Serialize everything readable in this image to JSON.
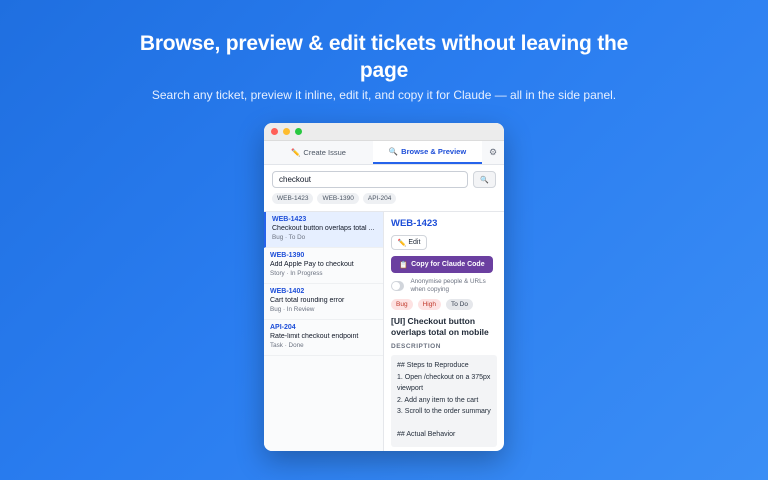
{
  "hero": {
    "title": "Browse, preview & edit tickets without leaving the page",
    "subtitle": "Search any ticket, preview it inline, edit it, and copy it for Claude — all in the side panel."
  },
  "window": {
    "traffic_lights": [
      "#ff5f57",
      "#febc2e",
      "#28c840"
    ]
  },
  "tabs": {
    "create": {
      "icon": "pencil-icon",
      "glyph": "✏️",
      "label": "Create Issue"
    },
    "browse": {
      "icon": "search-icon",
      "glyph": "🔍",
      "label": "Browse & Preview"
    },
    "settings": {
      "icon": "gear-icon",
      "glyph": "⚙"
    }
  },
  "search": {
    "value": "checkout",
    "button_glyph": "🔍"
  },
  "recent_chips": [
    "WEB-1423",
    "WEB-1390",
    "API-204"
  ],
  "tickets": [
    {
      "key": "WEB-1423",
      "title": "Checkout button overlaps total ...",
      "meta": "Bug · To Do"
    },
    {
      "key": "WEB-1390",
      "title": "Add Apple Pay to checkout",
      "meta": "Story · In Progress"
    },
    {
      "key": "WEB-1402",
      "title": "Cart total rounding error",
      "meta": "Bug · In Review"
    },
    {
      "key": "API-204",
      "title": "Rate-limit checkout endpoint",
      "meta": "Task · Done"
    }
  ],
  "detail": {
    "key": "WEB-1423",
    "edit_label": "Edit",
    "edit_glyph": "✏️",
    "copy_label": "Copy for Claude Code",
    "copy_glyph": "📋",
    "anon_label": "Anonymise people & URLs when copying",
    "badges": {
      "type": "Bug",
      "priority": "High",
      "status": "To Do"
    },
    "title": "[UI] Checkout button overlaps total on mobile",
    "description_label": "DESCRIPTION",
    "description_lines": [
      "## Steps to Reproduce",
      "1. Open /checkout on a 375px viewport",
      "2. Add any item to the cart",
      "3. Scroll to the order summary",
      "",
      "## Actual Behavior"
    ]
  },
  "colors": {
    "accent": "#2563eb",
    "copy_button": "#6b3fa0"
  }
}
